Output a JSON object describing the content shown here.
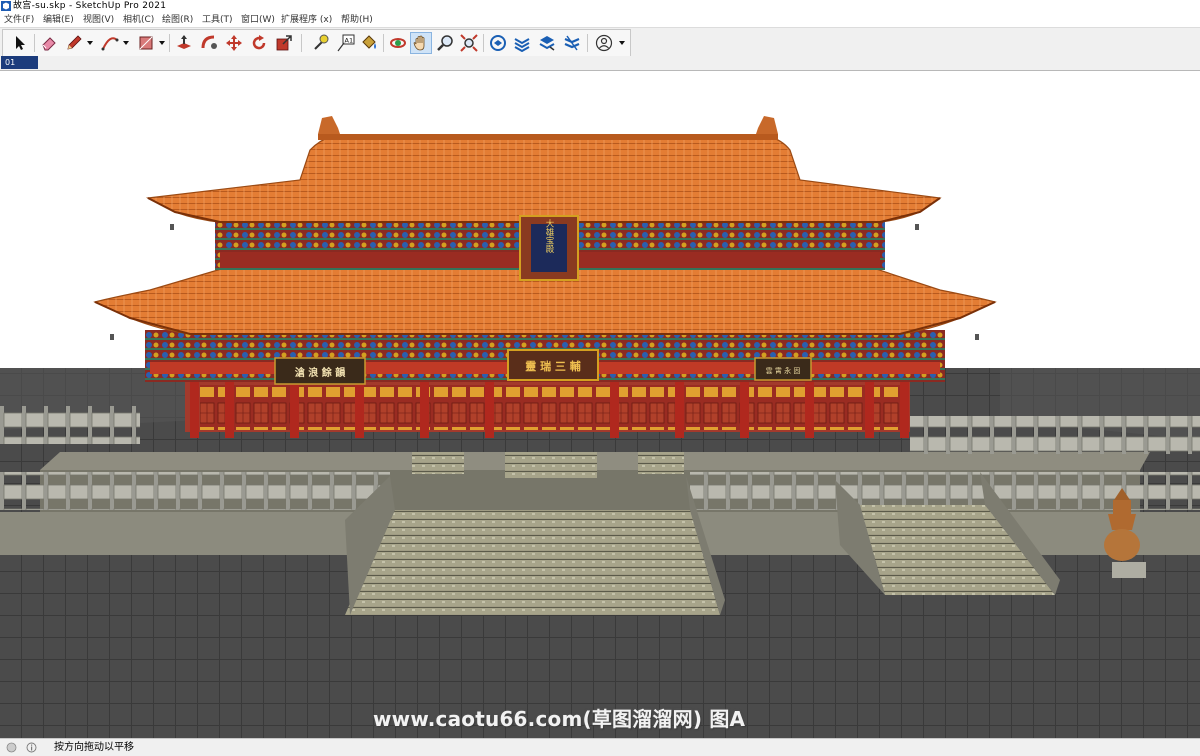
{
  "window": {
    "title": "故宫-su.skp - SketchUp Pro 2021"
  },
  "menubar": {
    "items": [
      {
        "label": "文件(F)"
      },
      {
        "label": "编辑(E)"
      },
      {
        "label": "视图(V)"
      },
      {
        "label": "相机(C)"
      },
      {
        "label": "绘图(R)"
      },
      {
        "label": "工具(T)"
      },
      {
        "label": "窗口(W)"
      },
      {
        "label": "扩展程序 (x)"
      },
      {
        "label": "帮助(H)"
      }
    ]
  },
  "toolbar": {
    "tools": [
      {
        "icon": "select-arrow-icon"
      },
      {
        "icon": "eraser-icon"
      },
      {
        "icon": "pencil-line-icon"
      },
      {
        "icon": "arc-icon"
      },
      {
        "icon": "rectangle-icon"
      },
      {
        "icon": "push-pull-icon"
      },
      {
        "icon": "follow-me-icon"
      },
      {
        "icon": "move-icon"
      },
      {
        "icon": "rotate-icon"
      },
      {
        "icon": "scale-icon"
      },
      {
        "icon": "tape-measure-icon"
      },
      {
        "icon": "text-label-icon"
      },
      {
        "icon": "paint-bucket-icon"
      },
      {
        "icon": "orbit-icon"
      },
      {
        "icon": "pan-hand-icon"
      },
      {
        "icon": "zoom-icon"
      },
      {
        "icon": "zoom-extents-icon"
      },
      {
        "icon": "3d-warehouse-icon"
      },
      {
        "icon": "extension-warehouse-icon"
      },
      {
        "icon": "layout-send-icon"
      },
      {
        "icon": "extension-manager-icon"
      },
      {
        "icon": "user-account-icon"
      }
    ],
    "text_tool_glyph": "A1",
    "active_tool": "pan-hand-icon"
  },
  "scenes": {
    "tabs": [
      {
        "label": "01"
      }
    ]
  },
  "viewport": {
    "plaques": {
      "top_vertical": "大雄宝殿",
      "center": "靈 瑞 三 輔",
      "left": "滄 浪 餘 韻",
      "right": "雲 霄 永 固"
    },
    "colors": {
      "roof": "#e07a30",
      "wall": "#a33a2c",
      "sky": "#ffffff",
      "ground": "#4a4a4a"
    }
  },
  "watermark": {
    "text": "www.caotu66.com(草图溜溜网) 图A"
  },
  "status": {
    "text": "按方向拖动以平移"
  }
}
